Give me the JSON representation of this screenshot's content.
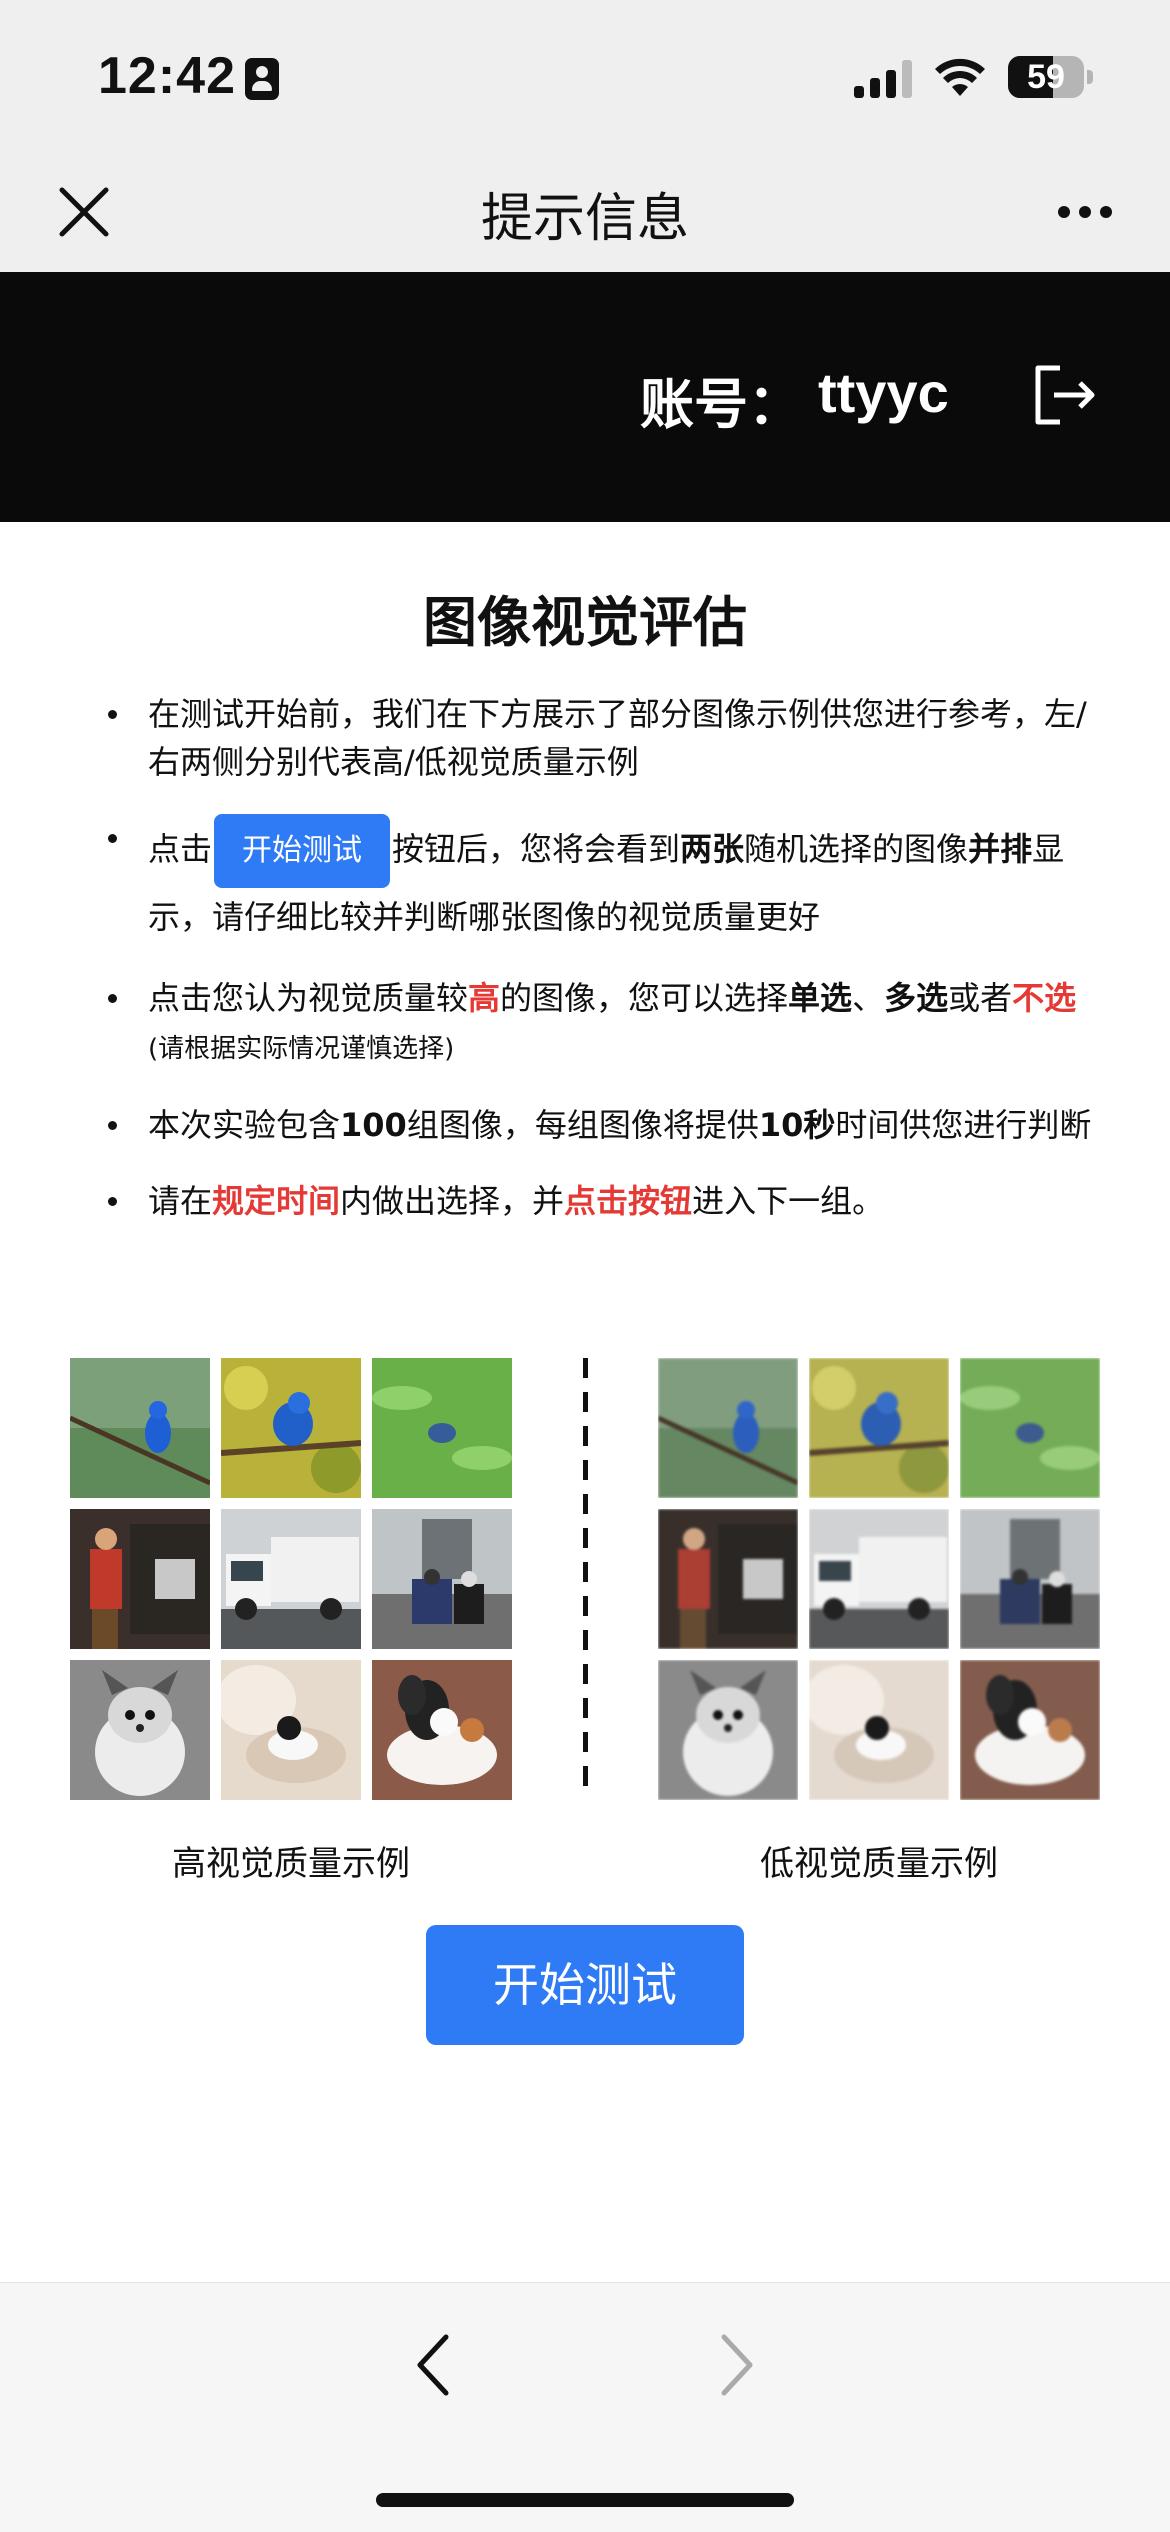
{
  "status": {
    "time": "12:42",
    "battery": "59",
    "icons": [
      "person-card-icon",
      "signal-icon",
      "wifi-icon",
      "battery-icon"
    ]
  },
  "nav": {
    "title": "提示信息",
    "close_icon": "close-icon",
    "more_icon": "more-icon"
  },
  "account": {
    "label": "账号：",
    "name": "ttyyc",
    "logout_icon": "logout-icon"
  },
  "content": {
    "heading": "图像视觉评估",
    "bullet1": "在测试开始前，我们在下方展示了部分图像示例供您进行参考，左/右两侧分别代表高/低视觉质量示例",
    "bullet2": {
      "pre": "点击",
      "button": "开始测试",
      "mid1": "按钮后，您将会看到",
      "bold1": "两张",
      "mid2": "随机选择的图像",
      "bold2": "并排",
      "post": "显示，请仔细比较并判断哪张图像的视觉质量更好"
    },
    "bullet3": {
      "pre": "点击您认为视觉质量较",
      "red1": "高",
      "mid1": "的图像，您可以选择",
      "bold1": "单选",
      "sep": "、",
      "bold2": "多选",
      "mid2": "或者",
      "red2": "不选",
      "note": "(请根据实际情况谨慎选择)"
    },
    "bullet4": {
      "pre": "本次实验包含",
      "bold1": "100",
      "mid": "组图像，每组图像将提供",
      "bold2": "10秒",
      "post": "时间供您进行判断"
    },
    "bullet5": {
      "pre": "请在",
      "red1": "规定时间",
      "mid": "内做出选择，并",
      "red2": "点击按钮",
      "post": "进入下一组。"
    },
    "left_caption": "高视觉质量示例",
    "right_caption": "低视觉质量示例",
    "start_button": "开始测试"
  },
  "thumbnails": [
    "bird-on-branch",
    "bird-in-yellow-leaves",
    "bird-in-green-leaves",
    "garbage-worker",
    "garbage-truck",
    "street-with-motorcycle",
    "fluffy-dog",
    "cat-on-pillow",
    "papillon-dog"
  ],
  "colors": {
    "accent": "#2f7bf6",
    "highlight_red": "#e53935",
    "header_black": "#0a0a0a",
    "chrome_gray": "#efefef"
  },
  "toolbar": {
    "back_icon": "chevron-left-icon",
    "forward_icon": "chevron-right-icon"
  }
}
